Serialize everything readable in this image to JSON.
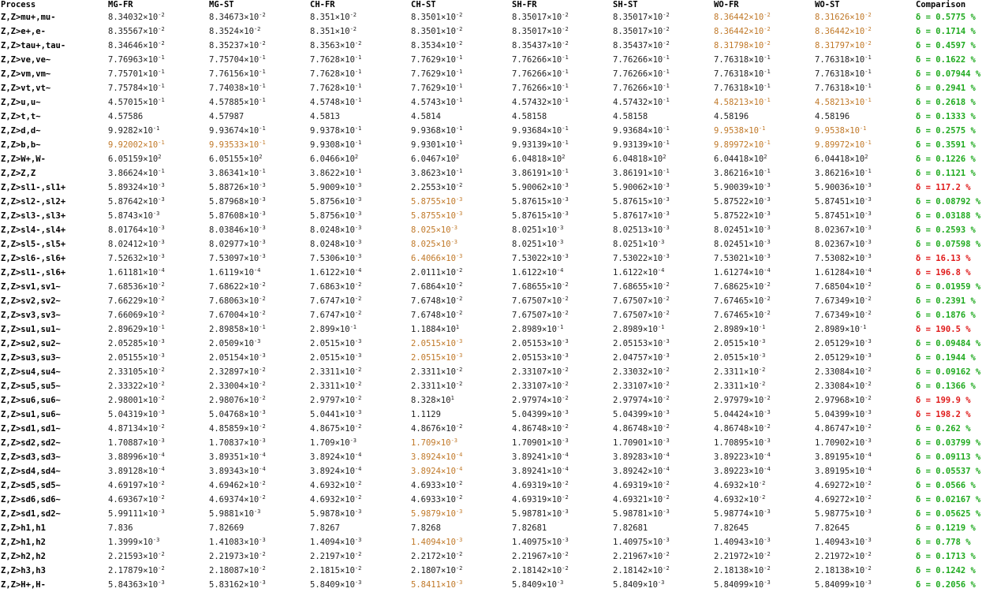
{
  "headers": [
    "Process",
    "MG-FR",
    "MG-ST",
    "CH-FR",
    "CH-ST",
    "SH-FR",
    "SH-ST",
    "WO-FR",
    "WO-ST",
    "Comparison"
  ],
  "colors": {
    "highlight": "#c07828",
    "ok": "#1faa1f",
    "bad": "#e01a1a"
  },
  "rows": [
    {
      "process": "Z,Z>mu+,mu-",
      "values": [
        "8.34032|-2",
        "8.34673|-2",
        "8.351|-2",
        "8.3501|-2",
        "8.35017|-2",
        "8.35017|-2",
        "8.36442|-2",
        "8.31626|-2"
      ],
      "hl": [
        6,
        7
      ],
      "cmp": "δ = 0.5775 %",
      "bad": false
    },
    {
      "process": "Z,Z>e+,e-",
      "values": [
        "8.35567|-2",
        "8.3524|-2",
        "8.351|-2",
        "8.3501|-2",
        "8.35017|-2",
        "8.35017|-2",
        "8.36442|-2",
        "8.36442|-2"
      ],
      "hl": [
        6,
        7
      ],
      "cmp": "δ = 0.1714 %",
      "bad": false
    },
    {
      "process": "Z,Z>tau+,tau-",
      "values": [
        "8.34646|-2",
        "8.35237|-2",
        "8.3563|-2",
        "8.3534|-2",
        "8.35437|-2",
        "8.35437|-2",
        "8.31798|-2",
        "8.31797|-2"
      ],
      "hl": [
        6,
        7
      ],
      "cmp": "δ = 0.4597 %",
      "bad": false
    },
    {
      "process": "Z,Z>ve,ve~",
      "values": [
        "7.76963|-1",
        "7.75704|-1",
        "7.7628|-1",
        "7.7629|-1",
        "7.76266|-1",
        "7.76266|-1",
        "7.76318|-1",
        "7.76318|-1"
      ],
      "hl": [],
      "cmp": "δ = 0.1622 %",
      "bad": false
    },
    {
      "process": "Z,Z>vm,vm~",
      "values": [
        "7.75701|-1",
        "7.76156|-1",
        "7.7628|-1",
        "7.7629|-1",
        "7.76266|-1",
        "7.76266|-1",
        "7.76318|-1",
        "7.76318|-1"
      ],
      "hl": [],
      "cmp": "δ = 0.07944 %",
      "bad": false
    },
    {
      "process": "Z,Z>vt,vt~",
      "values": [
        "7.75784|-1",
        "7.74038|-1",
        "7.7628|-1",
        "7.7629|-1",
        "7.76266|-1",
        "7.76266|-1",
        "7.76318|-1",
        "7.76318|-1"
      ],
      "hl": [],
      "cmp": "δ = 0.2941 %",
      "bad": false
    },
    {
      "process": "Z,Z>u,u~",
      "values": [
        "4.57015|-1",
        "4.57885|-1",
        "4.5748|-1",
        "4.5743|-1",
        "4.57432|-1",
        "4.57432|-1",
        "4.58213|-1",
        "4.58213|-1"
      ],
      "hl": [
        6,
        7
      ],
      "cmp": "δ = 0.2618 %",
      "bad": false
    },
    {
      "process": "Z,Z>t,t~",
      "values": [
        "4.57586",
        "4.57987",
        "4.5813",
        "4.5814",
        "4.58158",
        "4.58158",
        "4.58196",
        "4.58196"
      ],
      "hl": [],
      "cmp": "δ = 0.1333 %",
      "bad": false
    },
    {
      "process": "Z,Z>d,d~",
      "values": [
        "9.9282|-1",
        "9.93674|-1",
        "9.9378|-1",
        "9.9368|-1",
        "9.93684|-1",
        "9.93684|-1",
        "9.9538|-1",
        "9.9538|-1"
      ],
      "hl": [
        6,
        7
      ],
      "cmp": "δ = 0.2575 %",
      "bad": false
    },
    {
      "process": "Z,Z>b,b~",
      "values": [
        "9.92002|-1",
        "9.93533|-1",
        "9.9308|-1",
        "9.9301|-1",
        "9.93139|-1",
        "9.93139|-1",
        "9.89972|-1",
        "9.89972|-1"
      ],
      "hl": [
        0,
        1,
        6,
        7
      ],
      "cmp": "δ = 0.3591 %",
      "bad": false
    },
    {
      "process": "Z,Z>W+,W-",
      "values": [
        "6.05159|2",
        "6.05155|2",
        "6.0466|2",
        "6.0467|2",
        "6.04818|2",
        "6.04818|2",
        "6.04418|2",
        "6.04418|2"
      ],
      "hl": [],
      "cmp": "δ = 0.1226 %",
      "bad": false
    },
    {
      "process": "Z,Z>Z,Z",
      "values": [
        "3.86624|-1",
        "3.86341|-1",
        "3.8622|-1",
        "3.8623|-1",
        "3.86191|-1",
        "3.86191|-1",
        "3.86216|-1",
        "3.86216|-1"
      ],
      "hl": [],
      "cmp": "δ = 0.1121 %",
      "bad": false
    },
    {
      "process": "Z,Z>sl1-,sl1+",
      "values": [
        "5.89324|-3",
        "5.88726|-3",
        "5.9009|-3",
        "2.2553|-2",
        "5.90062|-3",
        "5.90062|-3",
        "5.90039|-3",
        "5.90036|-3"
      ],
      "hl": [],
      "cmp": "δ = 117.2 %",
      "bad": true
    },
    {
      "process": "Z,Z>sl2-,sl2+",
      "values": [
        "5.87642|-3",
        "5.87968|-3",
        "5.8756|-3",
        "5.8755|-3",
        "5.87615|-3",
        "5.87615|-3",
        "5.87522|-3",
        "5.87451|-3"
      ],
      "hl": [
        3
      ],
      "cmp": "δ = 0.08792 %",
      "bad": false
    },
    {
      "process": "Z,Z>sl3-,sl3+",
      "values": [
        "5.8743|-3",
        "5.87608|-3",
        "5.8756|-3",
        "5.8755|-3",
        "5.87615|-3",
        "5.87617|-3",
        "5.87522|-3",
        "5.87451|-3"
      ],
      "hl": [
        3
      ],
      "cmp": "δ = 0.03188 %",
      "bad": false
    },
    {
      "process": "Z,Z>sl4-,sl4+",
      "values": [
        "8.01764|-3",
        "8.03846|-3",
        "8.0248|-3",
        "8.025|-3",
        "8.0251|-3",
        "8.02513|-3",
        "8.02451|-3",
        "8.02367|-3"
      ],
      "hl": [
        3
      ],
      "cmp": "δ = 0.2593 %",
      "bad": false
    },
    {
      "process": "Z,Z>sl5-,sl5+",
      "values": [
        "8.02412|-3",
        "8.02977|-3",
        "8.0248|-3",
        "8.025|-3",
        "8.0251|-3",
        "8.0251|-3",
        "8.02451|-3",
        "8.02367|-3"
      ],
      "hl": [
        3
      ],
      "cmp": "δ = 0.07598 %",
      "bad": false
    },
    {
      "process": "Z,Z>sl6-,sl6+",
      "values": [
        "7.52632|-3",
        "7.53097|-3",
        "7.5306|-3",
        "6.4066|-3",
        "7.53022|-3",
        "7.53022|-3",
        "7.53021|-3",
        "7.53082|-3"
      ],
      "hl": [
        3
      ],
      "cmp": "δ = 16.13 %",
      "bad": true
    },
    {
      "process": "Z,Z>sl1-,sl6+",
      "values": [
        "1.61181|-4",
        "1.6119|-4",
        "1.6122|-4",
        "2.0111|-2",
        "1.6122|-4",
        "1.6122|-4",
        "1.61274|-4",
        "1.61284|-4"
      ],
      "hl": [],
      "cmp": "δ = 196.8 %",
      "bad": true
    },
    {
      "process": "Z,Z>sv1,sv1~",
      "values": [
        "7.68536|-2",
        "7.68622|-2",
        "7.6863|-2",
        "7.6864|-2",
        "7.68655|-2",
        "7.68655|-2",
        "7.68625|-2",
        "7.68504|-2"
      ],
      "hl": [],
      "cmp": "δ = 0.01959 %",
      "bad": false
    },
    {
      "process": "Z,Z>sv2,sv2~",
      "values": [
        "7.66229|-2",
        "7.68063|-2",
        "7.6747|-2",
        "7.6748|-2",
        "7.67507|-2",
        "7.67507|-2",
        "7.67465|-2",
        "7.67349|-2"
      ],
      "hl": [],
      "cmp": "δ = 0.2391 %",
      "bad": false
    },
    {
      "process": "Z,Z>sv3,sv3~",
      "values": [
        "7.66069|-2",
        "7.67004|-2",
        "7.6747|-2",
        "7.6748|-2",
        "7.67507|-2",
        "7.67507|-2",
        "7.67465|-2",
        "7.67349|-2"
      ],
      "hl": [],
      "cmp": "δ = 0.1876 %",
      "bad": false
    },
    {
      "process": "Z,Z>su1,su1~",
      "values": [
        "2.89629|-1",
        "2.89858|-1",
        "2.899|-1",
        "1.1884|1",
        "2.8989|-1",
        "2.8989|-1",
        "2.8989|-1",
        "2.8989|-1"
      ],
      "hl": [],
      "cmp": "δ = 190.5 %",
      "bad": true
    },
    {
      "process": "Z,Z>su2,su2~",
      "values": [
        "2.05285|-3",
        "2.0509|-3",
        "2.0515|-3",
        "2.0515|-3",
        "2.05153|-3",
        "2.05153|-3",
        "2.0515|-3",
        "2.05129|-3"
      ],
      "hl": [
        3
      ],
      "cmp": "δ = 0.09484 %",
      "bad": false
    },
    {
      "process": "Z,Z>su3,su3~",
      "values": [
        "2.05155|-3",
        "2.05154|-3",
        "2.0515|-3",
        "2.0515|-3",
        "2.05153|-3",
        "2.04757|-3",
        "2.0515|-3",
        "2.05129|-3"
      ],
      "hl": [
        3
      ],
      "cmp": "δ = 0.1944 %",
      "bad": false
    },
    {
      "process": "Z,Z>su4,su4~",
      "values": [
        "2.33105|-2",
        "2.32897|-2",
        "2.3311|-2",
        "2.3311|-2",
        "2.33107|-2",
        "2.33032|-2",
        "2.3311|-2",
        "2.33084|-2"
      ],
      "hl": [],
      "cmp": "δ = 0.09162 %",
      "bad": false
    },
    {
      "process": "Z,Z>su5,su5~",
      "values": [
        "2.33322|-2",
        "2.33004|-2",
        "2.3311|-2",
        "2.3311|-2",
        "2.33107|-2",
        "2.33107|-2",
        "2.3311|-2",
        "2.33084|-2"
      ],
      "hl": [],
      "cmp": "δ = 0.1366 %",
      "bad": false
    },
    {
      "process": "Z,Z>su6,su6~",
      "values": [
        "2.98001|-2",
        "2.98076|-2",
        "2.9797|-2",
        "8.328|1",
        "2.97974|-2",
        "2.97974|-2",
        "2.97979|-2",
        "2.97968|-2"
      ],
      "hl": [],
      "cmp": "δ = 199.9 %",
      "bad": true
    },
    {
      "process": "Z,Z>su1,su6~",
      "values": [
        "5.04319|-3",
        "5.04768|-3",
        "5.0441|-3",
        "1.1129",
        "5.04399|-3",
        "5.04399|-3",
        "5.04424|-3",
        "5.04399|-3"
      ],
      "hl": [],
      "cmp": "δ = 198.2 %",
      "bad": true
    },
    {
      "process": "Z,Z>sd1,sd1~",
      "values": [
        "4.87134|-2",
        "4.85859|-2",
        "4.8675|-2",
        "4.8676|-2",
        "4.86748|-2",
        "4.86748|-2",
        "4.86748|-2",
        "4.86747|-2"
      ],
      "hl": [],
      "cmp": "δ = 0.262 %",
      "bad": false
    },
    {
      "process": "Z,Z>sd2,sd2~",
      "values": [
        "1.70887|-3",
        "1.70837|-3",
        "1.709|-3",
        "1.709|-3",
        "1.70901|-3",
        "1.70901|-3",
        "1.70895|-3",
        "1.70902|-3"
      ],
      "hl": [
        3
      ],
      "cmp": "δ = 0.03799 %",
      "bad": false
    },
    {
      "process": "Z,Z>sd3,sd3~",
      "values": [
        "3.88996|-4",
        "3.89351|-4",
        "3.8924|-4",
        "3.8924|-4",
        "3.89241|-4",
        "3.89283|-4",
        "3.89223|-4",
        "3.89195|-4"
      ],
      "hl": [
        3
      ],
      "cmp": "δ = 0.09113 %",
      "bad": false
    },
    {
      "process": "Z,Z>sd4,sd4~",
      "values": [
        "3.89128|-4",
        "3.89343|-4",
        "3.8924|-4",
        "3.8924|-4",
        "3.89241|-4",
        "3.89242|-4",
        "3.89223|-4",
        "3.89195|-4"
      ],
      "hl": [
        3
      ],
      "cmp": "δ = 0.05537 %",
      "bad": false
    },
    {
      "process": "Z,Z>sd5,sd5~",
      "values": [
        "4.69197|-2",
        "4.69462|-2",
        "4.6932|-2",
        "4.6933|-2",
        "4.69319|-2",
        "4.69319|-2",
        "4.6932|-2",
        "4.69272|-2"
      ],
      "hl": [],
      "cmp": "δ = 0.0566 %",
      "bad": false
    },
    {
      "process": "Z,Z>sd6,sd6~",
      "values": [
        "4.69367|-2",
        "4.69374|-2",
        "4.6932|-2",
        "4.6933|-2",
        "4.69319|-2",
        "4.69321|-2",
        "4.6932|-2",
        "4.69272|-2"
      ],
      "hl": [],
      "cmp": "δ = 0.02167 %",
      "bad": false
    },
    {
      "process": "Z,Z>sd1,sd2~",
      "values": [
        "5.99111|-3",
        "5.9881|-3",
        "5.9878|-3",
        "5.9879|-3",
        "5.98781|-3",
        "5.98781|-3",
        "5.98774|-3",
        "5.98775|-3"
      ],
      "hl": [
        3
      ],
      "cmp": "δ = 0.05625 %",
      "bad": false
    },
    {
      "process": "Z,Z>h1,h1",
      "values": [
        "7.836",
        "7.82669",
        "7.8267",
        "7.8268",
        "7.82681",
        "7.82681",
        "7.82645",
        "7.82645"
      ],
      "hl": [],
      "cmp": "δ = 0.1219 %",
      "bad": false
    },
    {
      "process": "Z,Z>h1,h2",
      "values": [
        "1.3999|-3",
        "1.41083|-3",
        "1.4094|-3",
        "1.4094|-3",
        "1.40975|-3",
        "1.40975|-3",
        "1.40943|-3",
        "1.40943|-3"
      ],
      "hl": [
        3
      ],
      "cmp": "δ = 0.778 %",
      "bad": false
    },
    {
      "process": "Z,Z>h2,h2",
      "values": [
        "2.21593|-2",
        "2.21973|-2",
        "2.2197|-2",
        "2.2172|-2",
        "2.21967|-2",
        "2.21967|-2",
        "2.21972|-2",
        "2.21972|-2"
      ],
      "hl": [],
      "cmp": "δ = 0.1713 %",
      "bad": false
    },
    {
      "process": "Z,Z>h3,h3",
      "values": [
        "2.17879|-2",
        "2.18087|-2",
        "2.1815|-2",
        "2.1807|-2",
        "2.18142|-2",
        "2.18142|-2",
        "2.18138|-2",
        "2.18138|-2"
      ],
      "hl": [],
      "cmp": "δ = 0.1242 %",
      "bad": false
    },
    {
      "process": "Z,Z>H+,H-",
      "values": [
        "5.84363|-3",
        "5.83162|-3",
        "5.8409|-3",
        "5.8411|-3",
        "5.8409|-3",
        "5.8409|-3",
        "5.84099|-3",
        "5.84099|-3"
      ],
      "hl": [
        3
      ],
      "cmp": "δ = 0.2056 %",
      "bad": false
    }
  ]
}
